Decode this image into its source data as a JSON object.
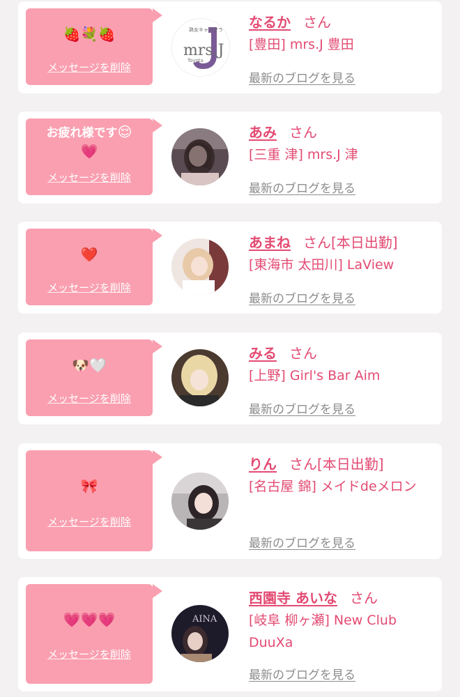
{
  "common": {
    "delete_label": "メッセージを削除",
    "blog_label": "最新のブログを見る",
    "san": "さん"
  },
  "colors": {
    "bubble": "#fa9fb0",
    "accent": "#e34a72",
    "link_gray": "#8c8c8c",
    "background": "#f3f1f2"
  },
  "cards": [
    {
      "message": "🍓💐🍓",
      "name": "なるか",
      "status": "",
      "shop": "[豊田] mrs.J 豊田",
      "avatar_text": "mrs.J",
      "avatar_sub": "Toyota",
      "avatar_top": "熟女キャバクラ"
    },
    {
      "message_text": "お疲れ様です",
      "message": "😌",
      "message2": "💗",
      "name": "あみ",
      "status": "",
      "shop": "[三重 津] mrs.J 津"
    },
    {
      "message": "❤️",
      "name": "あまね",
      "status": "[本日出勤]",
      "shop": "[東海市 太田川] LaView"
    },
    {
      "message": "🐶🤍",
      "name": "みる",
      "status": "",
      "shop": "[上野] Girl's Bar Aim"
    },
    {
      "message": "🎀",
      "name": "りん",
      "status": "[本日出勤]",
      "shop": "[名古屋 錦] メイドdeメロン"
    },
    {
      "message": "💗💗💗",
      "name": "西園寺 あいな",
      "status": "",
      "shop": "[岐阜 柳ヶ瀬] New Club DuuXa",
      "avatar_text": "AINA"
    }
  ]
}
